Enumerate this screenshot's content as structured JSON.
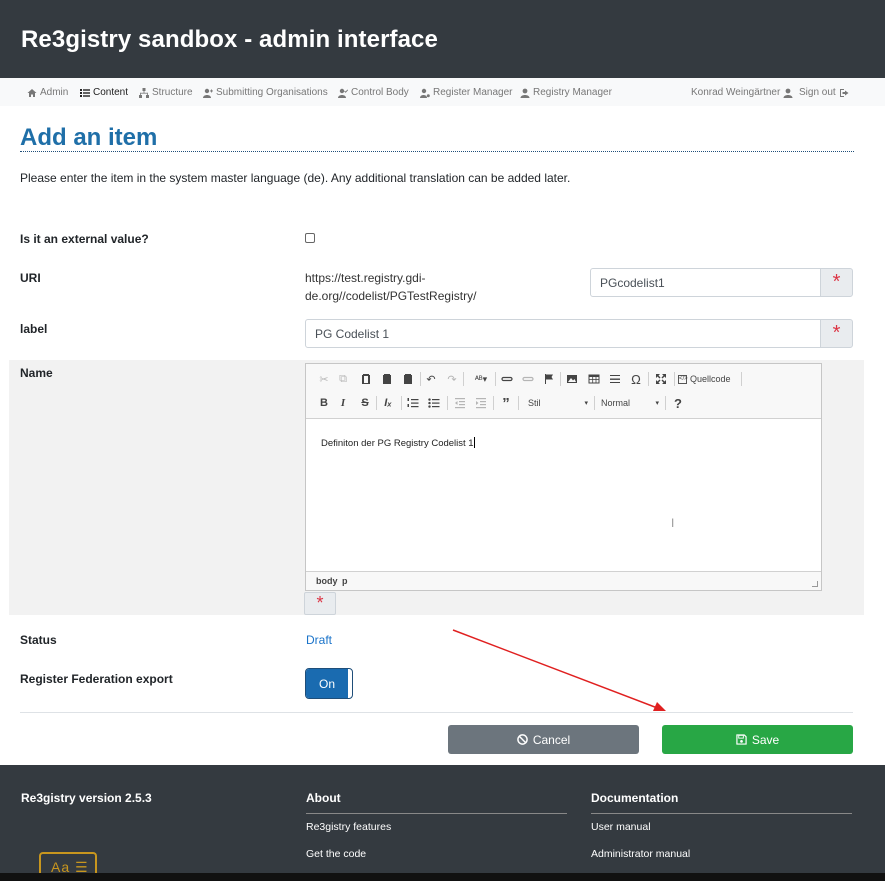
{
  "header": {
    "title": "Re3gistry sandbox - admin interface"
  },
  "nav": {
    "items": [
      {
        "label": "Admin",
        "icon": "home-icon"
      },
      {
        "label": "Content",
        "icon": "list-icon"
      },
      {
        "label": "Structure",
        "icon": "sitemap-icon"
      },
      {
        "label": "Submitting Organisations",
        "icon": "user-plus-icon"
      },
      {
        "label": "Control Body",
        "icon": "user-check-icon"
      },
      {
        "label": "Register Manager",
        "icon": "user-cog-icon"
      },
      {
        "label": "Registry Manager",
        "icon": "user-tie-icon"
      }
    ],
    "user": "Konrad Weingärtner",
    "signout": "Sign out"
  },
  "page": {
    "title": "Add an item",
    "intro": "Please enter the item in the system master language (de). Any additional translation can be added later."
  },
  "form": {
    "external_label": "Is it an external value?",
    "external_checked": false,
    "uri_label": "URI",
    "uri_base": "https://test.registry.gdi-de.org//codelist/PGTestRegistry/",
    "uri_value": "PGcodelist1",
    "label_label": "label",
    "label_value": "PG Codelist 1",
    "name_label": "Name",
    "required_mark": "*",
    "status_label": "Status",
    "status_value": "Draft",
    "federation_label": "Register Federation export",
    "federation_value": "On"
  },
  "editor": {
    "source_label": "Quellcode",
    "style_combo": "Stil",
    "format_combo": "Normal",
    "help": "?",
    "content": "Definiton der PG Registry Codelist 1",
    "path_body": "body",
    "path_p": "p"
  },
  "buttons": {
    "cancel": "Cancel",
    "save": "Save"
  },
  "footer": {
    "version": "Re3gistry version 2.5.3",
    "about_heading": "About",
    "about_links": [
      "Re3gistry features",
      "Get the code"
    ],
    "docs_heading": "Documentation",
    "docs_links": [
      "User manual",
      "Administrator manual"
    ],
    "logo_text": "Aa"
  },
  "colors": {
    "header_bg": "#343a40",
    "title_blue": "#1f6fa8",
    "required_red": "#dc3545",
    "toggle_blue": "#1a6bb0",
    "cancel_gray": "#6c757d",
    "save_green": "#28a745",
    "annotation_arrow": "#e02020"
  }
}
